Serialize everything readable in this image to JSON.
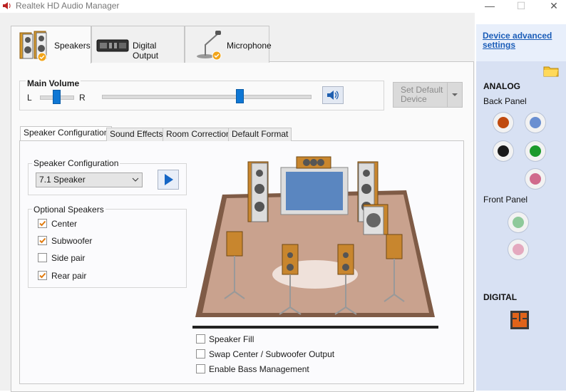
{
  "window": {
    "title": "Realtek HD Audio Manager",
    "minimize_icon": "—",
    "maximize_icon": "☐",
    "close_icon": "✕"
  },
  "device_tabs": [
    {
      "label": "Speakers",
      "icon": "speakers-icon"
    },
    {
      "label": "Digital Output",
      "icon": "digital-output-icon"
    },
    {
      "label": "Microphone",
      "icon": "microphone-icon"
    }
  ],
  "main_volume": {
    "title": "Main Volume",
    "left_label": "L",
    "right_label": "R",
    "balance_fraction": 0.5,
    "volume_fraction": 0.66
  },
  "set_default_label": "Set Default\nDevice",
  "inner_tabs": [
    "Speaker Configuration",
    "Sound Effects",
    "Room Correction",
    "Default Format"
  ],
  "speaker_config": {
    "group_title": "Speaker Configuration",
    "selected": "7.1 Speaker"
  },
  "optional_speakers": {
    "group_title": "Optional Speakers",
    "items": [
      {
        "label": "Center",
        "checked": true
      },
      {
        "label": "Subwoofer",
        "checked": true
      },
      {
        "label": "Side pair",
        "checked": false
      },
      {
        "label": "Rear pair",
        "checked": true
      }
    ]
  },
  "bottom_options": [
    {
      "label": "Speaker Fill",
      "checked": false
    },
    {
      "label": "Swap Center / Subwoofer Output",
      "checked": false
    },
    {
      "label": "Enable Bass Management",
      "checked": false
    }
  ],
  "right_panel": {
    "advanced_link": "Device advanced settings",
    "analog_title": "ANALOG",
    "back_panel_label": "Back Panel",
    "front_panel_label": "Front Panel",
    "digital_title": "DIGITAL",
    "back_jacks": [
      "#c04a0e",
      "#6a8fd1",
      "#1a1a1a",
      "#1c9a2b",
      "#d06a8c"
    ],
    "front_jacks": [
      "#8ec99a",
      "#e4a9bf"
    ]
  },
  "colors": {
    "accent": "#0f77d4",
    "check": "#e07b10",
    "floor": "#c9a28e"
  }
}
